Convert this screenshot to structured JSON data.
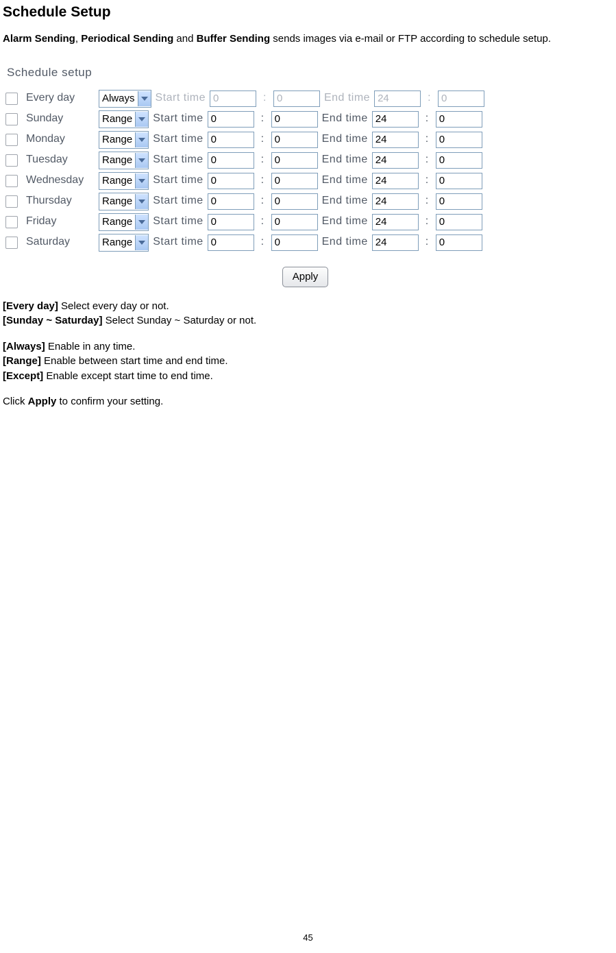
{
  "title": "Schedule Setup",
  "intro": {
    "b1": "Alarm Sending",
    "t1": ", ",
    "b2": "Periodical Sending",
    "t2": " and ",
    "b3": "Buffer Sending",
    "t3": " sends images via e-mail or FTP according to schedule setup."
  },
  "panel": {
    "heading": "Schedule setup",
    "start_label": "Start time",
    "end_label": "End time",
    "colon": ":",
    "apply": "Apply",
    "rows": [
      {
        "day": "Every day",
        "mode": "Always",
        "sh": "0",
        "sm": "0",
        "eh": "24",
        "em": "0",
        "disabled": true
      },
      {
        "day": "Sunday",
        "mode": "Range",
        "sh": "0",
        "sm": "0",
        "eh": "24",
        "em": "0",
        "disabled": false
      },
      {
        "day": "Monday",
        "mode": "Range",
        "sh": "0",
        "sm": "0",
        "eh": "24",
        "em": "0",
        "disabled": false
      },
      {
        "day": "Tuesday",
        "mode": "Range",
        "sh": "0",
        "sm": "0",
        "eh": "24",
        "em": "0",
        "disabled": false
      },
      {
        "day": "Wednesday",
        "mode": "Range",
        "sh": "0",
        "sm": "0",
        "eh": "24",
        "em": "0",
        "disabled": false
      },
      {
        "day": "Thursday",
        "mode": "Range",
        "sh": "0",
        "sm": "0",
        "eh": "24",
        "em": "0",
        "disabled": false
      },
      {
        "day": "Friday",
        "mode": "Range",
        "sh": "0",
        "sm": "0",
        "eh": "24",
        "em": "0",
        "disabled": false
      },
      {
        "day": "Saturday",
        "mode": "Range",
        "sh": "0",
        "sm": "0",
        "eh": "24",
        "em": "0",
        "disabled": false
      }
    ]
  },
  "desc": {
    "l1b": "[Every day]",
    "l1t": " Select every day or not.",
    "l2b": "[Sunday ~ Saturday]",
    "l2t": " Select Sunday ~ Saturday or not.",
    "l3b": "[Always]",
    "l3t": " Enable in any time.",
    "l4b": "[Range]",
    "l4t": " Enable between start time and end time.",
    "l5b": "[Except]",
    "l5t": " Enable except start time to end time.",
    "l6a": "Click ",
    "l6b": "Apply",
    "l6c": " to confirm your setting."
  },
  "page_number": "45"
}
